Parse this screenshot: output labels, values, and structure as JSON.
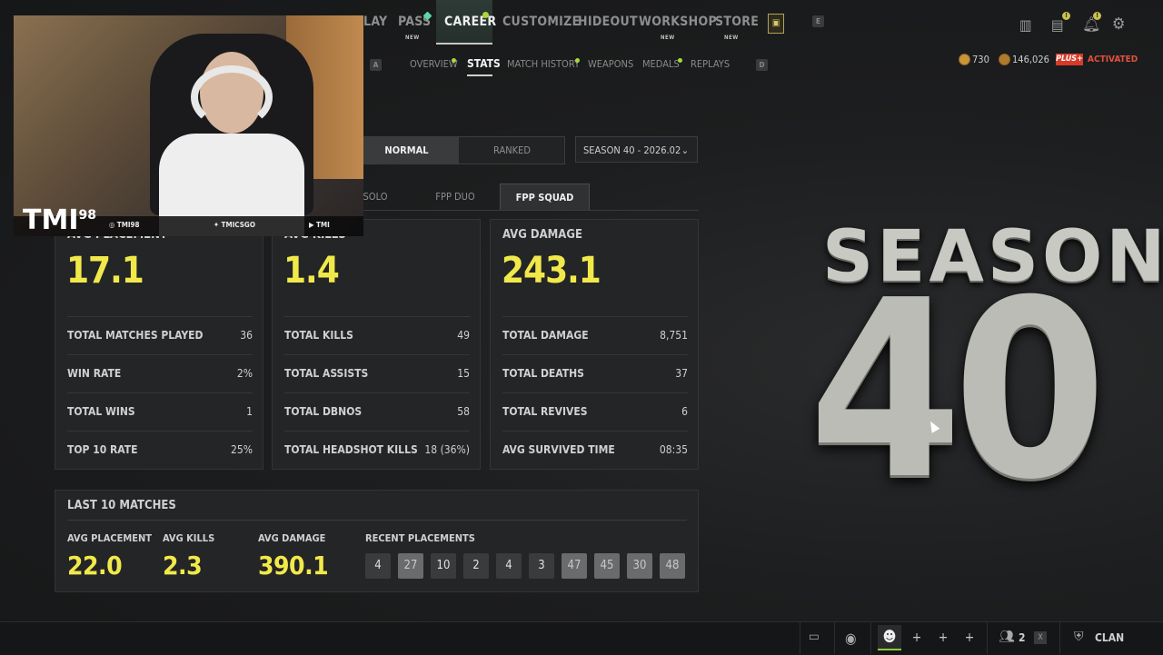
{
  "nav": {
    "items": [
      {
        "label": "LAY",
        "new": false
      },
      {
        "label": "PASS",
        "new": true
      },
      {
        "label": "CAREER",
        "new": false,
        "active": true
      },
      {
        "label": "CUSTOMIZE",
        "new": false
      },
      {
        "label": "HIDEOUT",
        "new": false
      },
      {
        "label": "WORKSHOP",
        "new": true
      },
      {
        "label": "STORE",
        "new": true
      }
    ],
    "new_label": "NEW",
    "keys": {
      "left_sub": "A",
      "right_sub": "D",
      "right_main": "E"
    }
  },
  "subnav": {
    "items": [
      "OVERVIEW",
      "STATS",
      "MATCH HISTORY",
      "WEAPONS",
      "MEDALS",
      "REPLAYS"
    ],
    "active": "STATS"
  },
  "currency": {
    "coins": "730",
    "bp": "146,026",
    "plus_label": "PLUS+",
    "plus_status": "ACTIVATED"
  },
  "mode_tabs": {
    "normal": "NORMAL",
    "ranked": "RANKED",
    "active": "NORMAL"
  },
  "season_select": {
    "value": "SEASON 40 - 2026.02"
  },
  "perspective_tabs": {
    "solo": "SOLO",
    "fpp_duo": "FPP DUO",
    "fpp_squad": "FPP SQUAD",
    "active": "FPP SQUAD"
  },
  "cards": [
    {
      "title": "AVG PLACEMENT",
      "big": "17.1",
      "rows": [
        {
          "label": "TOTAL MATCHES PLAYED",
          "value": "36"
        },
        {
          "label": "WIN RATE",
          "value": "2%"
        },
        {
          "label": "TOTAL WINS",
          "value": "1"
        },
        {
          "label": "TOP 10 RATE",
          "value": "25%"
        }
      ]
    },
    {
      "title": "AVG KILLS",
      "big": "1.4",
      "rows": [
        {
          "label": "TOTAL KILLS",
          "value": "49"
        },
        {
          "label": "TOTAL ASSISTS",
          "value": "15"
        },
        {
          "label": "TOTAL DBNOS",
          "value": "58"
        },
        {
          "label": "TOTAL HEADSHOT KILLS",
          "value": "18 (36%)"
        }
      ]
    },
    {
      "title": "AVG DAMAGE",
      "big": "243.1",
      "rows": [
        {
          "label": "TOTAL DAMAGE",
          "value": "8,751"
        },
        {
          "label": "TOTAL DEATHS",
          "value": "37"
        },
        {
          "label": "TOTAL REVIVES",
          "value": "6"
        },
        {
          "label": "AVG SURVIVED TIME",
          "value": "08:35"
        }
      ]
    }
  ],
  "last10": {
    "title": "LAST 10 MATCHES",
    "avg_placement_label": "AVG PLACEMENT",
    "avg_placement": "22.0",
    "avg_kills_label": "AVG KILLS",
    "avg_kills": "2.3",
    "avg_damage_label": "AVG DAMAGE",
    "avg_damage": "390.1",
    "recent_label": "RECENT PLACEMENTS",
    "recent": [
      {
        "v": "4",
        "top10": true
      },
      {
        "v": "27",
        "top10": false
      },
      {
        "v": "10",
        "top10": true
      },
      {
        "v": "2",
        "top10": true
      },
      {
        "v": "4",
        "top10": true
      },
      {
        "v": "3",
        "top10": true
      },
      {
        "v": "47",
        "top10": false
      },
      {
        "v": "45",
        "top10": false
      },
      {
        "v": "30",
        "top10": false
      },
      {
        "v": "48",
        "top10": false
      }
    ]
  },
  "webcam": {
    "logo": "TMI",
    "logo_sup": "98",
    "instagram": "TMI98",
    "twitter": "TMICSGO",
    "youtube": "TMI"
  },
  "season_art": {
    "word": "SEASON",
    "number": "40"
  },
  "bottombar": {
    "party_count": "2",
    "clan_label": "CLAN"
  },
  "colors": {
    "accent_yellow": "#f1e94a",
    "plus_red": "#d83a2a",
    "new_dot": "#a8d83a"
  }
}
